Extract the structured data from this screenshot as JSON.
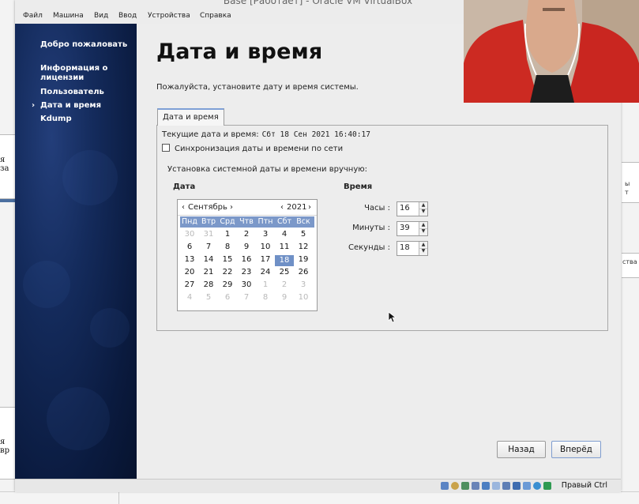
{
  "window": {
    "title": "Base [Работает] - Oracle VM VirtualBox"
  },
  "menu": [
    "Файл",
    "Машина",
    "Вид",
    "Ввод",
    "Устройства",
    "Справка"
  ],
  "sidebar": {
    "items": [
      {
        "label": "Добро пожаловать",
        "active": false
      },
      {
        "label": "Информация о лицензии",
        "active": false
      },
      {
        "label": "Пользователь",
        "active": false
      },
      {
        "label": "Дата и время",
        "active": true
      },
      {
        "label": "Kdump",
        "active": false
      }
    ]
  },
  "page": {
    "title": "Дата и время",
    "subtitle": "Пожалуйста, установите дату и время системы."
  },
  "tab": {
    "label": "Дата и время"
  },
  "datetime": {
    "current_label": "Текущие дата и время:",
    "current_value": "Сбт 18 Сен 2021 16:40:17",
    "sync_label": "Синхронизация даты и времени по сети",
    "sync_checked": false,
    "manual_label": "Установка системной даты и времени вручную:",
    "date_label": "Дата",
    "time_label": "Время"
  },
  "calendar": {
    "month": "Сентябрь",
    "year": "2021",
    "weekdays": [
      "Пнд",
      "Втр",
      "Срд",
      "Чтв",
      "Птн",
      "Сбт",
      "Вск"
    ],
    "weeks": [
      [
        "30",
        "31",
        "1",
        "2",
        "3",
        "4",
        "5"
      ],
      [
        "6",
        "7",
        "8",
        "9",
        "10",
        "11",
        "12"
      ],
      [
        "13",
        "14",
        "15",
        "16",
        "17",
        "18",
        "19"
      ],
      [
        "20",
        "21",
        "22",
        "23",
        "24",
        "25",
        "26"
      ],
      [
        "27",
        "28",
        "29",
        "30",
        "1",
        "2",
        "3"
      ],
      [
        "4",
        "5",
        "6",
        "7",
        "8",
        "9",
        "10"
      ]
    ],
    "selected_day": "18"
  },
  "time": {
    "hours_label": "Часы :",
    "hours": "16",
    "minutes_label": "Минуты :",
    "minutes": "39",
    "seconds_label": "Секунды :",
    "seconds": "18"
  },
  "buttons": {
    "back": "Назад",
    "forward": "Вперёд"
  },
  "statusbar": {
    "host_key": "Правый Ctrl"
  },
  "background": {
    "left_fragments": [
      "я за",
      "я вр"
    ],
    "right_fragments": [
      "ы",
      "т",
      "ства"
    ]
  }
}
